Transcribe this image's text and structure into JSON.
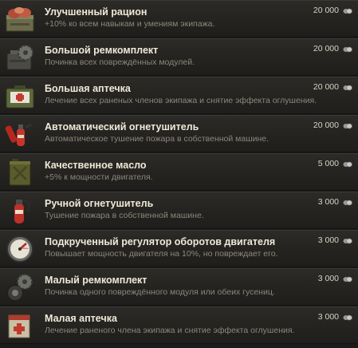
{
  "items": [
    {
      "title": "Улучшенный рацион",
      "desc": "+10% ко всем навыкам и умениям экипажа.",
      "price": "20 000",
      "icon": "food-crate-icon"
    },
    {
      "title": "Большой ремкомплект",
      "desc": "Починка всех повреждённых модулей.",
      "price": "20 000",
      "icon": "large-repair-kit-icon"
    },
    {
      "title": "Большая аптечка",
      "desc": "Лечение всех раненых членов экипажа и снятие эффекта оглушения.",
      "price": "20 000",
      "icon": "large-first-aid-kit-icon"
    },
    {
      "title": "Автоматический огнетушитель",
      "desc": "Автоматическое тушение пожара в собственной машине.",
      "price": "20 000",
      "icon": "automatic-extinguisher-icon"
    },
    {
      "title": "Качественное масло",
      "desc": "+5% к мощности двигателя.",
      "price": "5 000",
      "icon": "oil-canister-icon"
    },
    {
      "title": "Ручной огнетушитель",
      "desc": "Тушение пожара в собственной машине.",
      "price": "3 000",
      "icon": "manual-extinguisher-icon"
    },
    {
      "title": "Подкрученный регулятор оборотов двигателя",
      "desc": "Повышает мощность двигателя на 10%, но повреждает его.",
      "price": "3 000",
      "icon": "speed-governor-gauge-icon"
    },
    {
      "title": "Малый ремкомплект",
      "desc": "Починка одного повреждённого модуля или обеих гусениц.",
      "price": "3 000",
      "icon": "small-repair-kit-icon"
    },
    {
      "title": "Малая аптечка",
      "desc": "Лечение раненого члена экипажа и снятие эффекта оглушения.",
      "price": "3 000",
      "icon": "small-first-aid-kit-icon"
    }
  ],
  "currency_icon": "silver-coin-icon"
}
